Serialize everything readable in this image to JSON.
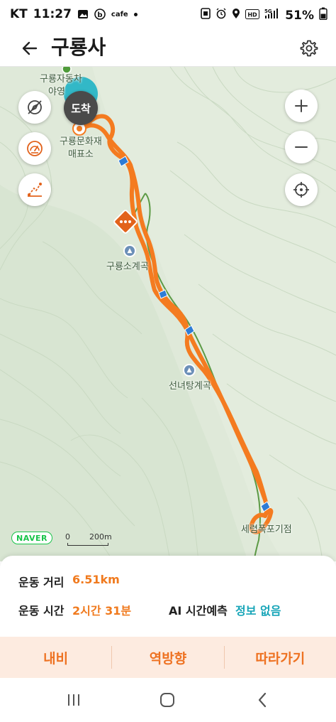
{
  "status_bar": {
    "carrier": "KT",
    "time": "11:27",
    "app_icons": [
      "gallery-icon",
      "band-icon"
    ],
    "cafe_label": "cafe",
    "right_icons": [
      "notification-icon",
      "alarm-icon",
      "location-icon",
      "hd-icon",
      "5g-signal-icon",
      "wifi-icon"
    ],
    "hd_label": "HD",
    "network_label": "5G",
    "battery": "51%"
  },
  "header": {
    "title": "구룡사",
    "back_icon": "arrow-left-icon",
    "settings_icon": "gear-icon"
  },
  "map": {
    "labels": {
      "campground": "구룡자동차",
      "campground_line2": "야영",
      "ticket_office_line1": "구룡문화재",
      "ticket_office_line2": "매표소",
      "valley": "구룡소계곡",
      "seonnyeotang": "선녀탕계곡",
      "falls": "세렴폭포기점"
    },
    "arrival_label": "도착",
    "zoom_in_icon": "plus-icon",
    "zoom_out_icon": "minus-icon",
    "locate_icon": "crosshair-icon",
    "side_buttons": [
      "compass-off-icon",
      "speedometer-icon",
      "elevation-icon"
    ],
    "brand": "NAVER",
    "scale_zero": "0",
    "scale_distance": "200m",
    "colors": {
      "route": "#f47b20",
      "trail": "#5c9a45",
      "map_bg": "#dfe9d9",
      "accent_teal": "#1fb3c4"
    }
  },
  "info": {
    "distance_label": "운동 거리",
    "distance_value": "6.51km",
    "time_label": "운동 시간",
    "time_value": "2시간 31분",
    "ai_label": "AI 시간예측",
    "ai_value": "정보 없음"
  },
  "actions": {
    "navi": "내비",
    "reverse": "역방향",
    "follow": "따라가기"
  },
  "nav_bar": {
    "icons": [
      "recent-apps-icon",
      "home-icon",
      "back-nav-icon"
    ]
  }
}
